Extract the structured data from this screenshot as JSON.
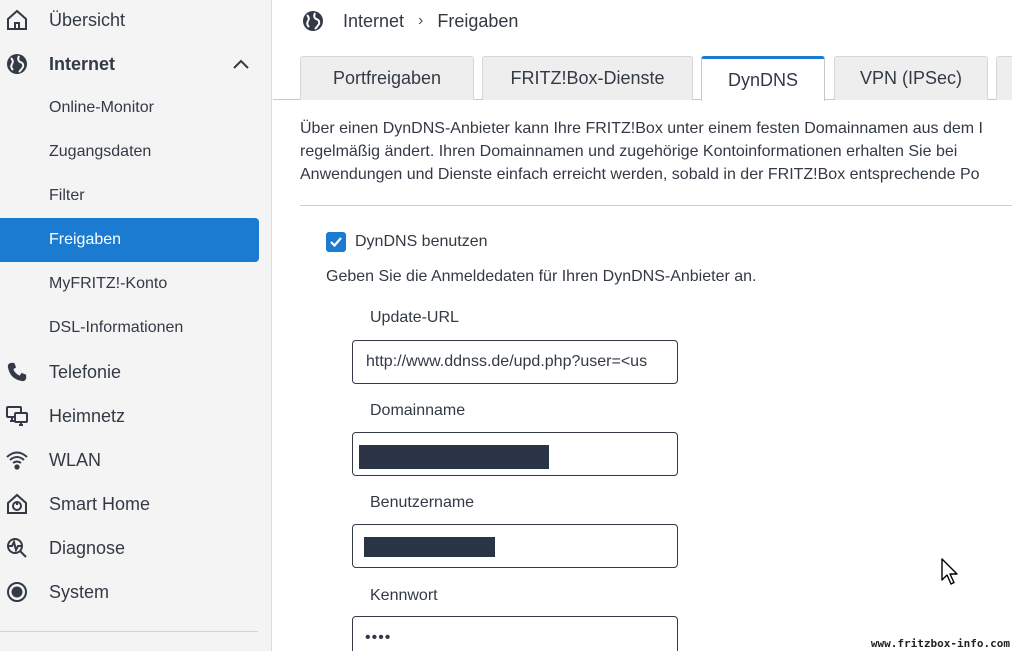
{
  "sidebar": {
    "items": [
      {
        "label": "Übersicht",
        "icon": "home-icon"
      },
      {
        "label": "Internet",
        "icon": "globe-icon",
        "expanded": true
      },
      {
        "label": "Online-Monitor"
      },
      {
        "label": "Zugangsdaten"
      },
      {
        "label": "Filter"
      },
      {
        "label": "Freigaben",
        "active": true
      },
      {
        "label": "MyFRITZ!-Konto"
      },
      {
        "label": "DSL-Informationen"
      },
      {
        "label": "Telefonie",
        "icon": "phone-icon"
      },
      {
        "label": "Heimnetz",
        "icon": "network-icon"
      },
      {
        "label": "WLAN",
        "icon": "wifi-icon"
      },
      {
        "label": "Smart Home",
        "icon": "smart-home-icon"
      },
      {
        "label": "Diagnose",
        "icon": "diagnose-icon"
      },
      {
        "label": "System",
        "icon": "system-icon"
      }
    ]
  },
  "breadcrumb": {
    "section": "Internet",
    "separator": "›",
    "page": "Freigaben"
  },
  "tabs": [
    {
      "label": "Portfreigaben"
    },
    {
      "label": "FRITZ!Box-Dienste"
    },
    {
      "label": "DynDNS",
      "active": true
    },
    {
      "label": "VPN (IPSec)"
    }
  ],
  "description": {
    "line1": "Über einen DynDNS-Anbieter kann Ihre FRITZ!Box unter einem festen Domainnamen aus dem I",
    "line2": "regelmäßig ändert. Ihren Domainnamen und zugehörige Kontoinformationen erhalten Sie bei",
    "line3": "Anwendungen und Dienste einfach erreicht werden, sobald in der FRITZ!Box entsprechende Po"
  },
  "form": {
    "checkbox_label": "DynDNS benutzen",
    "checkbox_checked": true,
    "hint": "Geben Sie die Anmeldedaten für Ihren DynDNS-Anbieter an.",
    "update_url_label": "Update-URL",
    "update_url_value": "http://www.ddnss.de/upd.php?user=<us",
    "domain_label": "Domainname",
    "username_label": "Benutzername",
    "password_label": "Kennwort",
    "password_value": "••••"
  },
  "watermark": "www.fritzbox-info.com",
  "colors": {
    "accent": "#1b7bd0",
    "text": "#333a45",
    "sidebar_bg": "#f4f4f4",
    "redaction": "#2a3445"
  }
}
